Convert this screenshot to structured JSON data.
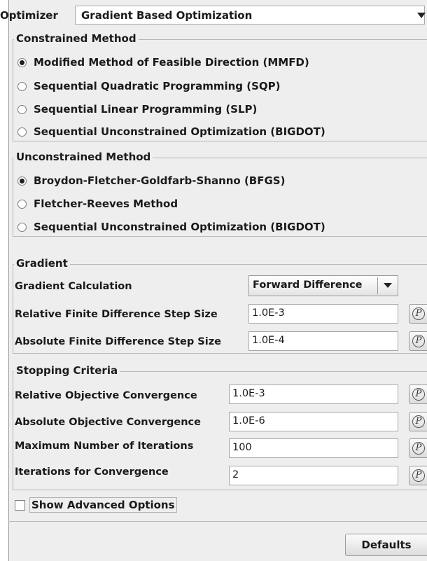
{
  "optimizer": {
    "label": "Optimizer",
    "selected": "Gradient Based Optimization",
    "arrow_icon": "triangle-down-icon"
  },
  "constrained": {
    "legend": "Constrained Method",
    "options": [
      {
        "label": "Modified Method of Feasible Direction (MMFD)",
        "selected": true
      },
      {
        "label": "Sequential Quadratic Programming (SQP)",
        "selected": false
      },
      {
        "label": "Sequential Linear Programming (SLP)",
        "selected": false
      },
      {
        "label": "Sequential Unconstrained Optimization (BIGDOT)",
        "selected": false
      }
    ]
  },
  "unconstrained": {
    "legend": "Unconstrained Method",
    "options": [
      {
        "label": "Broydon-Fletcher-Goldfarb-Shanno (BFGS)",
        "selected": true
      },
      {
        "label": "Fletcher-Reeves Method",
        "selected": false
      },
      {
        "label": "Sequential Unconstrained Optimization (BIGDOT)",
        "selected": false
      }
    ]
  },
  "gradient": {
    "legend": "Gradient",
    "calc_label": "Gradient Calculation",
    "calc_value": "Forward Difference",
    "rel_step_label": "Relative Finite Difference Step Size",
    "rel_step_value": "1.0E-3",
    "abs_step_label": "Absolute Finite Difference Step Size",
    "abs_step_value": "1.0E-4"
  },
  "stopping": {
    "legend": "Stopping Criteria",
    "rel_obj_label": "Relative Objective Convergence",
    "rel_obj_value": "1.0E-3",
    "abs_obj_label": "Absolute Objective Convergence",
    "abs_obj_value": "1.0E-6",
    "max_iter_label": "Maximum Number of Iterations",
    "max_iter_value": "100",
    "iter_conv_label": "Iterations for Convergence",
    "iter_conv_value": "2"
  },
  "parameter_button_glyph": "P",
  "advanced": {
    "label": "Show Advanced Options",
    "checked": false
  },
  "defaults_label": "Defaults"
}
